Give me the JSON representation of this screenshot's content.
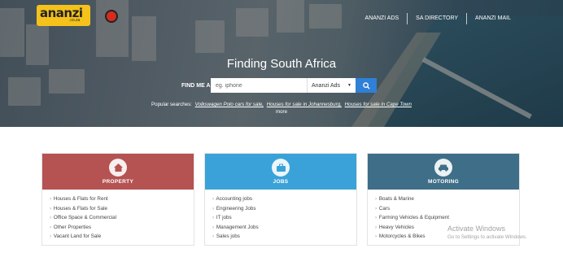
{
  "logo": {
    "text": "ananzi",
    "sub": ".co.za"
  },
  "topnav": [
    {
      "label": "ANANZI ADS"
    },
    {
      "label": "SA DIRECTORY"
    },
    {
      "label": "ANANZI MAIL"
    }
  ],
  "hero": {
    "title": "Finding South Africa",
    "find_label": "FIND ME A",
    "search_placeholder": "eg. iphone",
    "select_value": "Ananzi Ads",
    "popular_label": "Popular searches:",
    "popular_links": [
      "Volkswagen Polo cars for sale,",
      "Houses for sale in Johannesburg,",
      "Houses for sale in Cape Town"
    ],
    "more": "more"
  },
  "cards": [
    {
      "title": "PROPERTY",
      "color": "#b55252",
      "icon": "house-icon",
      "items": [
        "Houses & Flats for Rent",
        "Houses & Flats for Sale",
        "Office Space & Commercial",
        "Other Properties",
        "Vacant Land for Sale"
      ]
    },
    {
      "title": "JOBS",
      "color": "#3aa2d8",
      "icon": "briefcase-icon",
      "items": [
        "Accounting jobs",
        "Engineering Jobs",
        "IT jobs",
        "Management Jobs",
        "Sales jobs"
      ]
    },
    {
      "title": "MOTORING",
      "color": "#3f6e88",
      "icon": "car-icon",
      "items": [
        "Boats & Marine",
        "Cars",
        "Farming Vehicles & Equipment",
        "Heavy Vehicles",
        "Motorcycles & Bikes"
      ]
    }
  ],
  "watermark": {
    "line1": "Activate Windows",
    "line2": "Go to Settings to activate Windows."
  }
}
